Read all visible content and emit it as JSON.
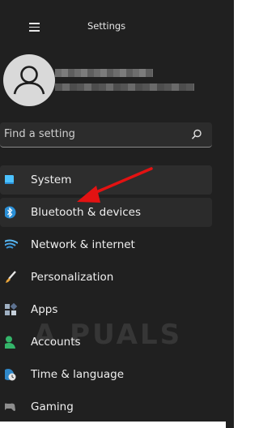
{
  "window": {
    "title": "Settings"
  },
  "account": {
    "name": "",
    "email": ""
  },
  "search": {
    "placeholder": "Find a setting"
  },
  "nav": {
    "items": [
      {
        "label": "System",
        "icon": "monitor-icon"
      },
      {
        "label": "Bluetooth & devices",
        "icon": "bluetooth-icon"
      },
      {
        "label": "Network & internet",
        "icon": "wifi-icon"
      },
      {
        "label": "Personalization",
        "icon": "brush-icon"
      },
      {
        "label": "Apps",
        "icon": "apps-icon"
      },
      {
        "label": "Accounts",
        "icon": "person-icon"
      },
      {
        "label": "Time & language",
        "icon": "globe-clock-icon"
      },
      {
        "label": "Gaming",
        "icon": "controller-icon"
      }
    ],
    "selected_index": 0
  },
  "watermark": {
    "text": "A  PUALS"
  },
  "colors": {
    "accent": "#4cc2ff",
    "annotation_arrow": "#e31212",
    "background": "#202020"
  }
}
